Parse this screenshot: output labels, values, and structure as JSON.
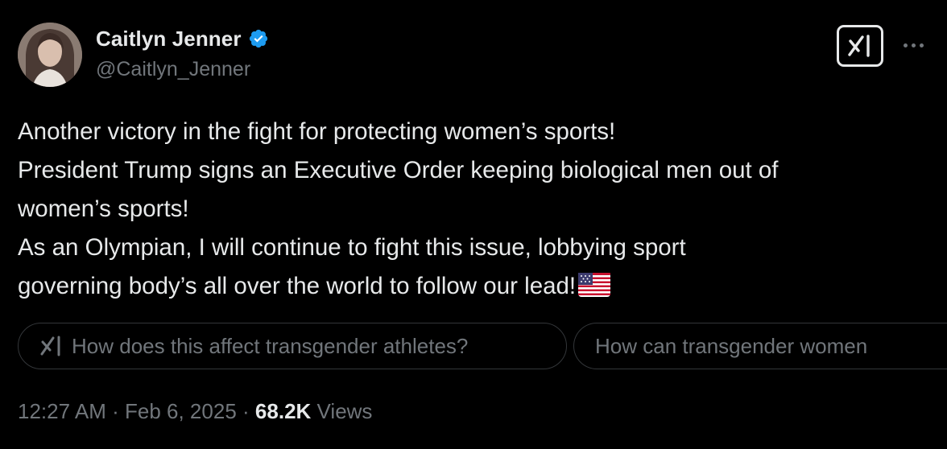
{
  "author": {
    "display_name": "Caitlyn Jenner",
    "handle": "@Caitlyn_Jenner",
    "verified": true,
    "verified_color": "#1d9bf0",
    "avatar_icon": "profile-photo"
  },
  "header_actions": {
    "grok_icon": "grok-icon",
    "more_icon": "more-dots-icon"
  },
  "tweet": {
    "lines": [
      "Another victory in the fight for protecting women’s sports!",
      "President Trump signs an Executive Order keeping biological men out of",
      "women’s sports!",
      "As an Olympian, I will continue to fight this issue, lobbying sport",
      "governing body’s all over the world to follow our lead!"
    ],
    "trailing_emoji": "us-flag-icon"
  },
  "suggestions": [
    {
      "label": "How does this affect transgender athletes?",
      "icon": "grok-icon"
    },
    {
      "label": "How can transgender women"
    }
  ],
  "meta": {
    "time": "12:27 AM",
    "separator": "·",
    "date": "Feb 6, 2025",
    "views_count": "68.2K",
    "views_label": "Views"
  },
  "colors": {
    "background": "#000000",
    "primary_text": "#e7e9ea",
    "secondary_text": "#71767b",
    "chip_border": "#333639"
  }
}
